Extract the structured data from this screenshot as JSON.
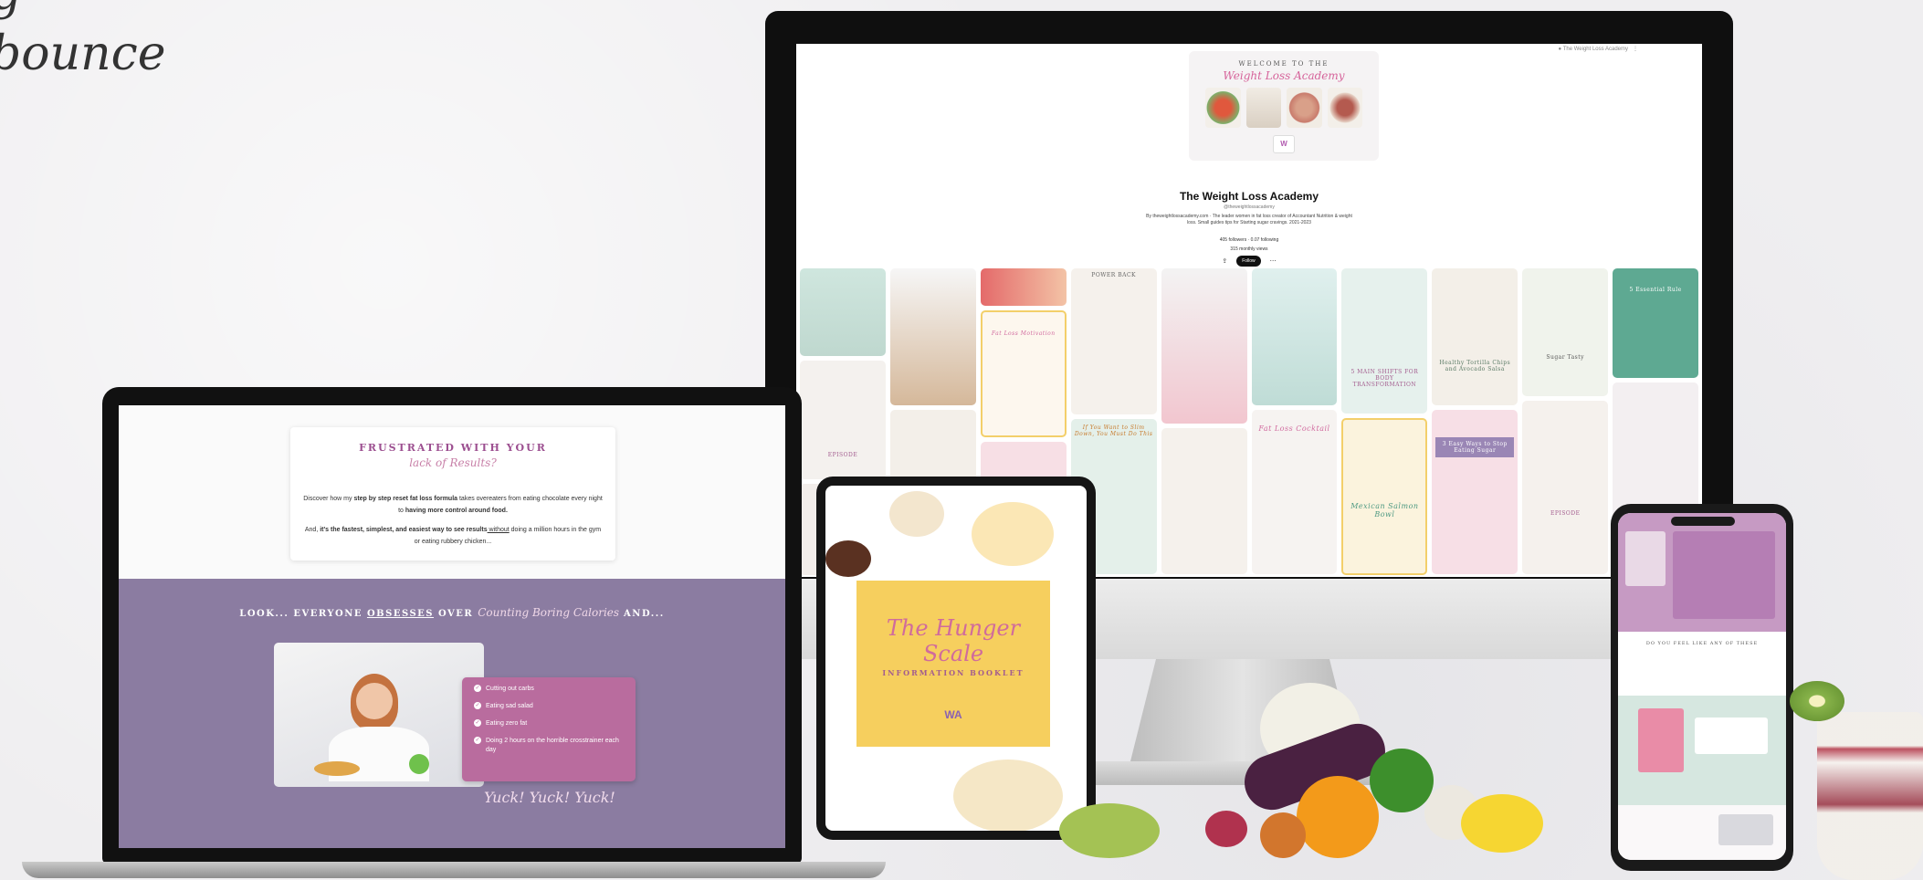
{
  "tagline": {
    "line1": "g",
    "line2": "bounce"
  },
  "monitor": {
    "profile_title": "The Weight Loss Academy",
    "handle": "@theweightlossacademy",
    "bio": "By theweightlossacademy.com · The leader women in fat loss creator of Accountant Nutrition & weight loss. Small guides tips for Starting sugar cravings. 2021-2023",
    "stats": "405 followers · 0.07 following",
    "views": "315 monthly views",
    "follow_label": "Follow",
    "cover_small": "WELCOME TO THE",
    "cover_script": "Weight Loss Academy",
    "pins": [
      "POWER BACK",
      "Fat Loss Motivation",
      "EPISODE",
      "5 MAIN SHIFTS FOR BODY TRANSFORMATION",
      "Healthy Tortilla Chips and Avocado Salsa",
      "Sugar Tasty",
      "5 Essential Rule",
      "If You Want to Slim Down, You Must Do This",
      "Fat Loss Cocktail",
      "Mexican Salmon Bowl",
      "3 Easy Ways to Stop Eating Sugar",
      "EPISODE"
    ]
  },
  "laptop": {
    "headline": "FRUSTRATED WITH YOUR",
    "script": "lack of Results?",
    "para1_a": "Discover how my ",
    "para1_b": "step by step reset fat loss formula",
    "para1_c": " takes overeaters from eating chocolate every night to ",
    "para1_d": "having more control around food.",
    "para2_a": "And, ",
    "para2_b": "it's the fastest, simplest, and easiest way to see results",
    "para2_c": " without",
    "para2_d": " doing a million hours in the gym or eating rubbery chicken...",
    "heading_a": "LOOK... EVERYONE ",
    "heading_b": "OBSESSES",
    "heading_c": " OVER ",
    "heading_d": "Counting Boring Calories",
    "heading_e": " AND...",
    "list": [
      "Cutting out carbs",
      "Eating sad salad",
      "Eating zero fat",
      "Doing 2 hours on the horrible crosstrainer each day"
    ],
    "yuck": "Yuck! Yuck! Yuck!"
  },
  "tablet": {
    "script": "The Hunger Scale",
    "subtitle": "INFORMATION BOOKLET",
    "logo": "WA"
  },
  "phone": {
    "section_heading": "DO YOU FEEL LIKE ANY OF THESE"
  },
  "colors": {
    "purple": "#8b7ca1",
    "pink": "#b96c9e",
    "yellow": "#f6cf5e",
    "mint": "#cfe3dc"
  }
}
